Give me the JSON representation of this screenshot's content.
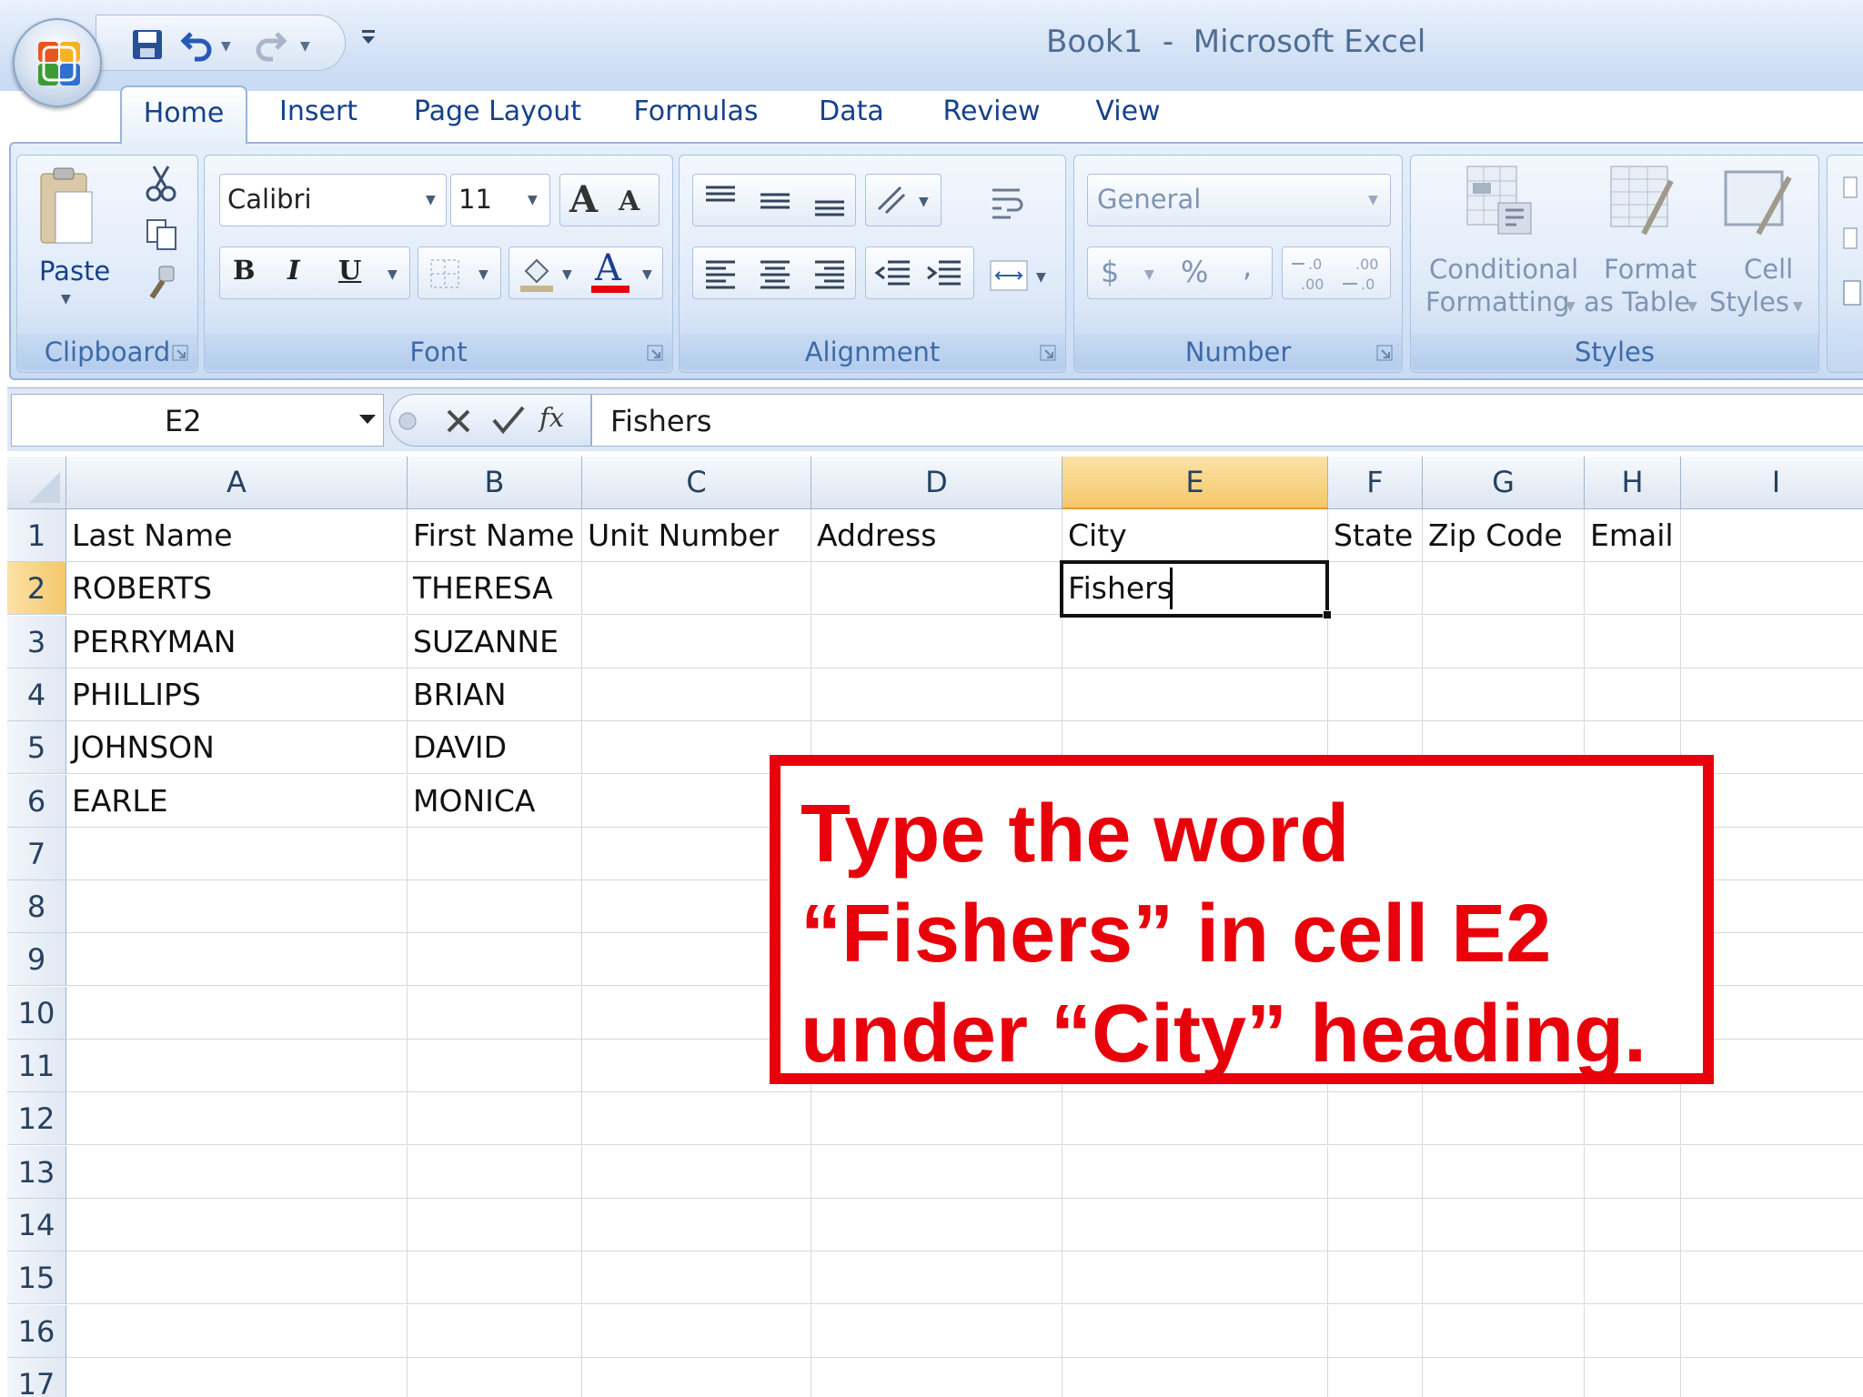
{
  "window": {
    "title": "Book1  -  Microsoft Excel"
  },
  "ribbon": {
    "tabs": [
      {
        "label": "Home",
        "active": true
      },
      {
        "label": "Insert"
      },
      {
        "label": "Page Layout"
      },
      {
        "label": "Formulas"
      },
      {
        "label": "Data"
      },
      {
        "label": "Review"
      },
      {
        "label": "View"
      }
    ],
    "clipboard": {
      "label": "Clipboard",
      "paste_label": "Paste"
    },
    "font": {
      "label": "Font",
      "font_name": "Calibri",
      "font_size": "11"
    },
    "alignment": {
      "label": "Alignment"
    },
    "number": {
      "label": "Number",
      "format": "General"
    },
    "styles": {
      "label": "Styles",
      "conditional_line1": "Conditional",
      "conditional_line2": "Formatting",
      "format_table_line1": "Format",
      "format_table_line2": "as Table",
      "cell_styles_line1": "Cell",
      "cell_styles_line2": "Styles"
    }
  },
  "formula_bar": {
    "name_box": "E2",
    "value": "Fishers"
  },
  "sheet": {
    "columns": [
      "A",
      "B",
      "C",
      "D",
      "E",
      "F",
      "G",
      "H",
      "I"
    ],
    "selected_column": "E",
    "rows": [
      "1",
      "2",
      "3",
      "4",
      "5",
      "6",
      "7",
      "8",
      "9",
      "10",
      "11",
      "12",
      "13",
      "14",
      "15",
      "16",
      "17"
    ],
    "selected_row": "2",
    "data": [
      [
        "Last Name",
        "First Name",
        "Unit Number",
        "Address",
        "City",
        "State",
        "Zip Code",
        "Email",
        ""
      ],
      [
        "ROBERTS",
        "THERESA",
        "",
        "",
        "Fishers",
        "",
        "",
        "",
        ""
      ],
      [
        "PERRYMAN",
        "SUZANNE",
        "",
        "",
        "",
        "",
        "",
        "",
        ""
      ],
      [
        "PHILLIPS",
        "BRIAN",
        "",
        "",
        "",
        "",
        "",
        "",
        ""
      ],
      [
        "JOHNSON",
        "DAVID",
        "",
        "",
        "",
        "",
        "",
        "",
        ""
      ],
      [
        "EARLE",
        "MONICA",
        "",
        "",
        "",
        "",
        "",
        "",
        ""
      ]
    ],
    "active_cell": "E2"
  },
  "annotation": {
    "line1": "Type the word",
    "line2": "“Fishers” in cell E2",
    "line3": "under “City” heading."
  },
  "colors": {
    "annotation": "#e8000b",
    "selected_header": "#f5c76b",
    "ribbon": "#d7e5f7"
  }
}
